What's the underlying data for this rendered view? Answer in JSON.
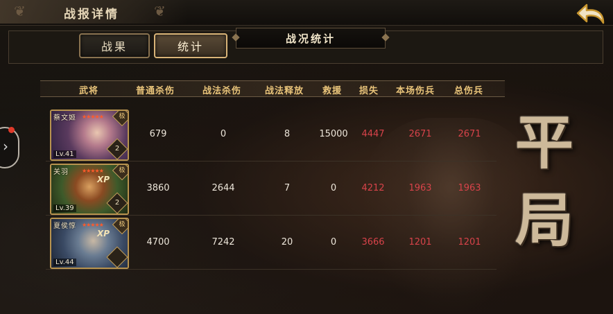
{
  "window": {
    "title": "战报详情"
  },
  "tabs": [
    {
      "label": "战果",
      "active": false
    },
    {
      "label": "统计",
      "active": true
    }
  ],
  "banner": "战况统计",
  "columns": [
    "武将",
    "普通杀伤",
    "战法杀伤",
    "战法释放",
    "救援",
    "损失",
    "本场伤兵",
    "总伤兵"
  ],
  "rows": [
    {
      "name": "蔡文姬",
      "level": "Lv.41",
      "stars": "★★★★★",
      "rank_badge": "极",
      "corner": "2",
      "xp": "",
      "normal_kills": "679",
      "skill_kills": "0",
      "skill_casts": "8",
      "rescue": "15000",
      "loss": "4447",
      "wounded_this": "2671",
      "wounded_total": "2671"
    },
    {
      "name": "关羽",
      "level": "Lv.39",
      "stars": "★★★★★",
      "rank_badge": "极",
      "corner": "2",
      "xp": "XP",
      "normal_kills": "3860",
      "skill_kills": "2644",
      "skill_casts": "7",
      "rescue": "0",
      "loss": "4212",
      "wounded_this": "1963",
      "wounded_total": "1963"
    },
    {
      "name": "夏侯惇",
      "level": "Lv.44",
      "stars": "★★★★★",
      "rank_badge": "极",
      "corner": "",
      "xp": "XP",
      "normal_kills": "4700",
      "skill_kills": "7242",
      "skill_casts": "20",
      "rescue": "0",
      "loss": "3666",
      "wounded_this": "1201",
      "wounded_total": "1201"
    }
  ],
  "result": "平局",
  "colors": {
    "accent": "#e9c47a",
    "loss_red": "#d8434a",
    "frame_gold": "#b8934f"
  }
}
